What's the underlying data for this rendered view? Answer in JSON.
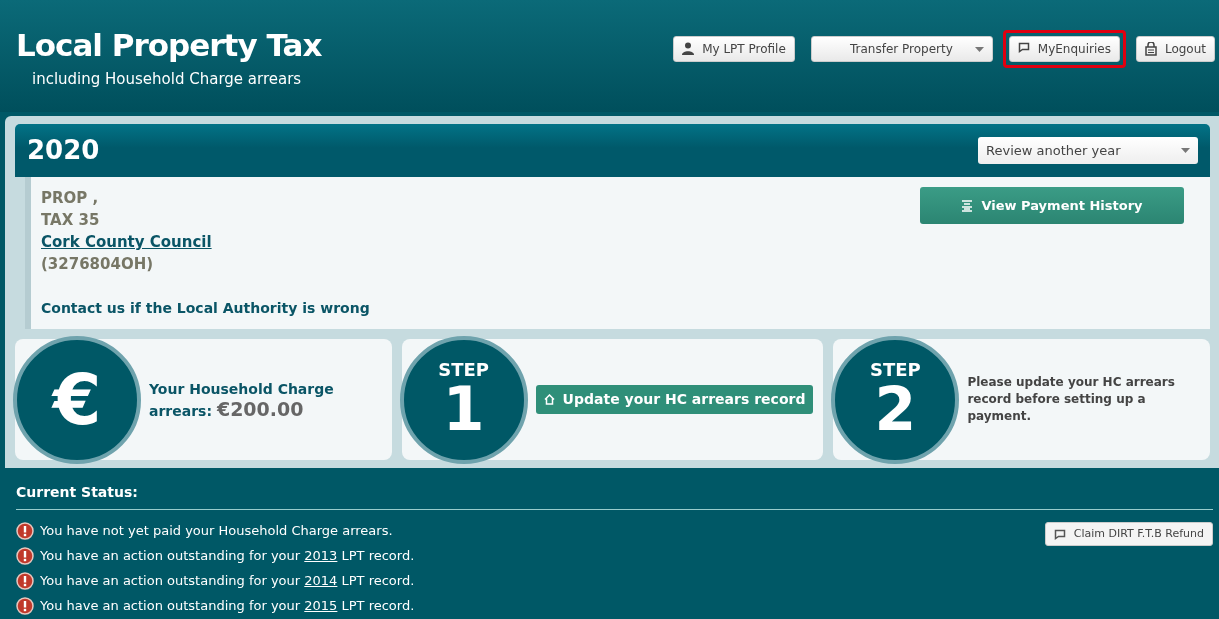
{
  "header": {
    "title": "Local Property Tax",
    "subtitle": "including Household Charge arrears"
  },
  "nav": [
    {
      "kind": "button",
      "label": "My LPT Profile",
      "highlighted": false
    },
    {
      "kind": "dropdown",
      "label": "Transfer Property",
      "highlighted": false
    },
    {
      "kind": "button",
      "label": "MyEnquiries",
      "highlighted": true
    },
    {
      "kind": "button",
      "label": "Logout",
      "highlighted": false
    }
  ],
  "year_bar": {
    "year": "2020",
    "select": "Review another year"
  },
  "property": {
    "lines": [
      "PROP ,",
      "TAX 35"
    ],
    "authority": "Cork County Council",
    "id": "(3276804OH)",
    "contact": "Contact us if the Local Authority is wrong",
    "history_button": "View Payment History"
  },
  "steps": [
    {
      "kind": "amount",
      "symbol": "€",
      "label": "Your Household Charge",
      "label2": "arrears:",
      "amount": "€200.00"
    },
    {
      "kind": "step",
      "step_label": "STEP",
      "number": "1",
      "button": "Update your HC arrears record"
    },
    {
      "kind": "step",
      "step_label": "STEP",
      "number": "2",
      "text": "Please update your HC arrears record before setting up a payment."
    }
  ],
  "status": {
    "title": "Current Status:",
    "refund_button": "Claim DIRT F.T.B Refund",
    "items": [
      {
        "before": "You have not yet paid your Household Charge arrears."
      },
      {
        "before": "You have an action outstanding for your ",
        "link": "2013",
        "after": " LPT record."
      },
      {
        "before": "You have an action outstanding for your ",
        "link": "2014",
        "after": " LPT record."
      },
      {
        "before": "You have an action outstanding for your ",
        "link": "2015",
        "after": " LPT record."
      }
    ]
  }
}
